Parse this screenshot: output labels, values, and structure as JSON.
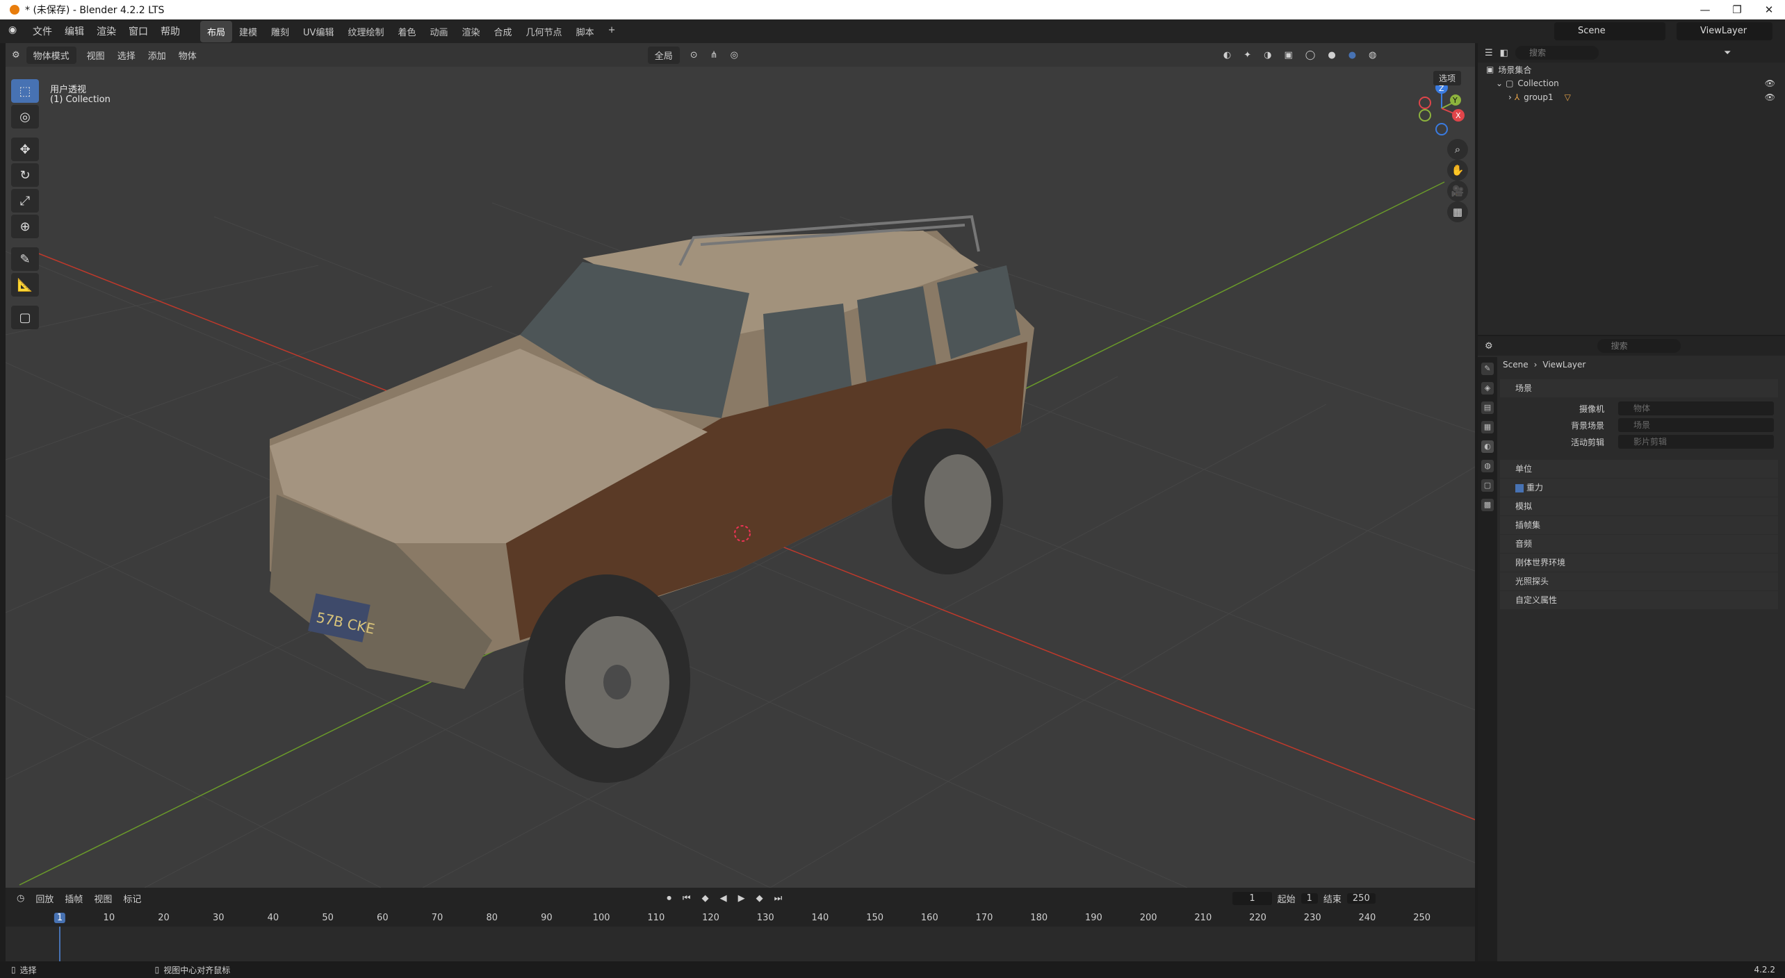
{
  "window": {
    "title": "* (未保存) - Blender 4.2.2 LTS",
    "controls": [
      "—",
      "❐",
      "✕"
    ]
  },
  "menu": [
    "文件",
    "编辑",
    "渲染",
    "窗口",
    "帮助"
  ],
  "workspaces": [
    "布局",
    "建模",
    "雕刻",
    "UV编辑",
    "纹理绘制",
    "着色",
    "动画",
    "渲染",
    "合成",
    "几何节点",
    "脚本",
    "+"
  ],
  "scene_selector": "Scene",
  "viewlayer_selector": "ViewLayer",
  "viewport": {
    "mode": "物体模式",
    "menus": [
      "视图",
      "选择",
      "添加",
      "物体"
    ],
    "transform_orientation": "全局",
    "options_label": "选项",
    "view_name": "用户透视",
    "collection_label": "(1) Collection",
    "gizmo": {
      "z": "Z",
      "y": "Y",
      "x": "X"
    },
    "plate": "57B CKE"
  },
  "timeline": {
    "menus": [
      "回放",
      "插帧",
      "视图",
      "标记"
    ],
    "current_frame": "1",
    "start_label": "起始",
    "start_value": "1",
    "end_label": "结束",
    "end_value": "250",
    "ticks": [
      "1",
      "10",
      "20",
      "30",
      "40",
      "50",
      "60",
      "70",
      "80",
      "90",
      "100",
      "110",
      "120",
      "130",
      "140",
      "150",
      "160",
      "170",
      "180",
      "190",
      "200",
      "210",
      "220",
      "230",
      "240",
      "250"
    ]
  },
  "status": {
    "left": "选择",
    "middle": "视图中心对齐鼠标",
    "version": "4.2.2"
  },
  "outliner": {
    "search_placeholder": "搜索",
    "root": "场景集合",
    "collection": "Collection",
    "object": "group1"
  },
  "properties": {
    "search_placeholder": "搜索",
    "breadcrumb_scene": "Scene",
    "breadcrumb_layer": "ViewLayer",
    "section_scene": "场景",
    "camera_label": "摄像机",
    "camera_placeholder": "物体",
    "bg_label": "背景场景",
    "bg_placeholder": "场景",
    "clip_label": "活动剪辑",
    "clip_placeholder": "影片剪辑",
    "panels": [
      "单位",
      "重力",
      "模拟",
      "插帧集",
      "音频",
      "刚体世界环境",
      "光照探头",
      "自定义属性"
    ]
  },
  "colors": {
    "accent": "#4772b3",
    "x_axis": "#c0392b",
    "y_axis": "#6a9a2a",
    "car_body": "#9c8b74",
    "wood": "#5a3a26"
  }
}
